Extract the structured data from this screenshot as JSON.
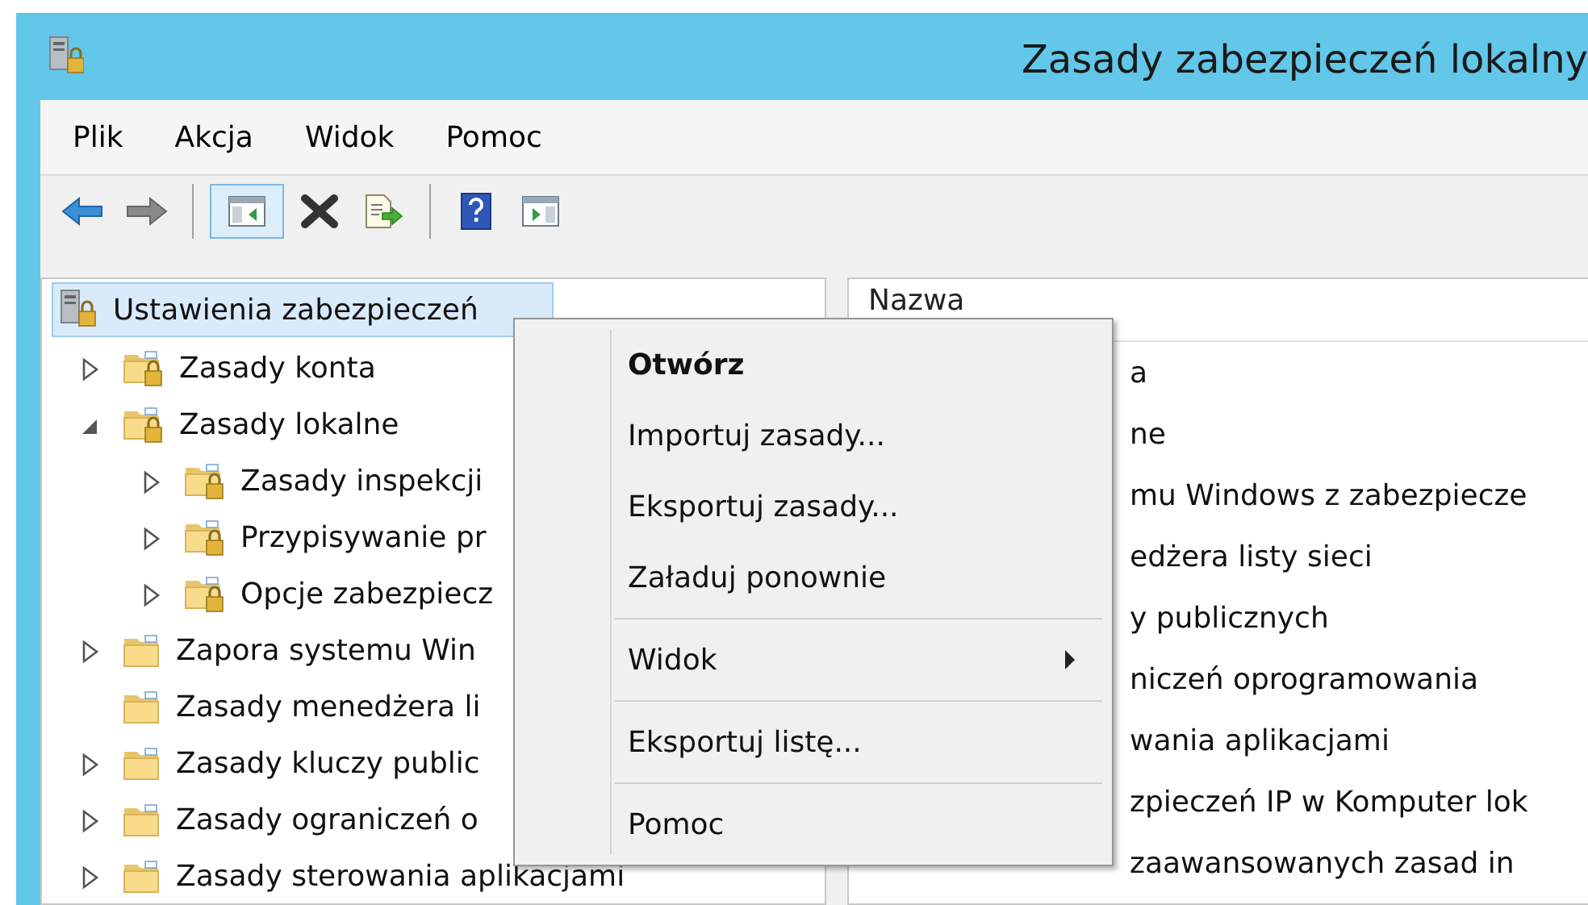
{
  "window": {
    "title": "Zasady zabezpieczeń lokalny"
  },
  "menu_bar": [
    "Plik",
    "Akcja",
    "Widok",
    "Pomoc"
  ],
  "toolbar": [
    {
      "kind": "back",
      "disabled": false
    },
    {
      "kind": "forward",
      "disabled": true
    },
    {
      "kind": "separator"
    },
    {
      "kind": "show-tree",
      "pressed": true
    },
    {
      "kind": "delete"
    },
    {
      "kind": "export"
    },
    {
      "kind": "separator"
    },
    {
      "kind": "help"
    },
    {
      "kind": "action-pane"
    }
  ],
  "tree": [
    {
      "label": "Ustawienia zabezpieczeń",
      "kind": "root",
      "selected": true,
      "children": [
        {
          "label": "Zasady konta",
          "kind": "policy",
          "selected": false,
          "expanded": false
        },
        {
          "label": "Zasady lokalne",
          "kind": "policy",
          "selected": false,
          "expanded": true,
          "children": [
            {
              "label": "Zasady inspekcji",
              "kind": "policy",
              "selected": false,
              "expanded": false
            },
            {
              "label": "Przypisywanie pr",
              "kind": "policy",
              "selected": false,
              "expanded": false
            },
            {
              "label": "Opcje zabezpiecz",
              "kind": "policy",
              "selected": false,
              "expanded": false
            }
          ]
        },
        {
          "label": "Zapora systemu Win",
          "kind": "folder",
          "selected": false,
          "expanded": false
        },
        {
          "label": "Zasady menedżera li",
          "kind": "folder",
          "selected": false
        },
        {
          "label": "Zasady kluczy public",
          "kind": "folder",
          "selected": false,
          "expanded": false
        },
        {
          "label": "Zasady ograniczeń o",
          "kind": "folder",
          "selected": false,
          "expanded": false
        },
        {
          "label": "Zasady sterowania aplikacjami",
          "kind": "folder",
          "selected": false,
          "expanded": false
        }
      ]
    }
  ],
  "list": {
    "column": "Nazwa",
    "rows": [
      "a",
      "ne",
      "mu Windows z zabezpiecze",
      "edżera listy sieci",
      "y publicznych",
      "niczeń oprogramowania",
      "wania aplikacjami",
      "zpieczeń IP w Komputer lok",
      "zaawansowanych zasad in"
    ]
  },
  "context_menu": [
    {
      "kind": "item",
      "label": "Otwórz",
      "default": true
    },
    {
      "kind": "item",
      "label": "Importuj zasady...",
      "default": false
    },
    {
      "kind": "item",
      "label": "Eksportuj zasady...",
      "default": false
    },
    {
      "kind": "item",
      "label": "Załaduj ponownie",
      "default": false
    },
    {
      "kind": "separator"
    },
    {
      "kind": "submenu",
      "label": "Widok",
      "default": false
    },
    {
      "kind": "separator"
    },
    {
      "kind": "item",
      "label": "Eksportuj listę...",
      "default": false
    },
    {
      "kind": "separator"
    },
    {
      "kind": "item",
      "label": "Pomoc",
      "default": false
    }
  ]
}
